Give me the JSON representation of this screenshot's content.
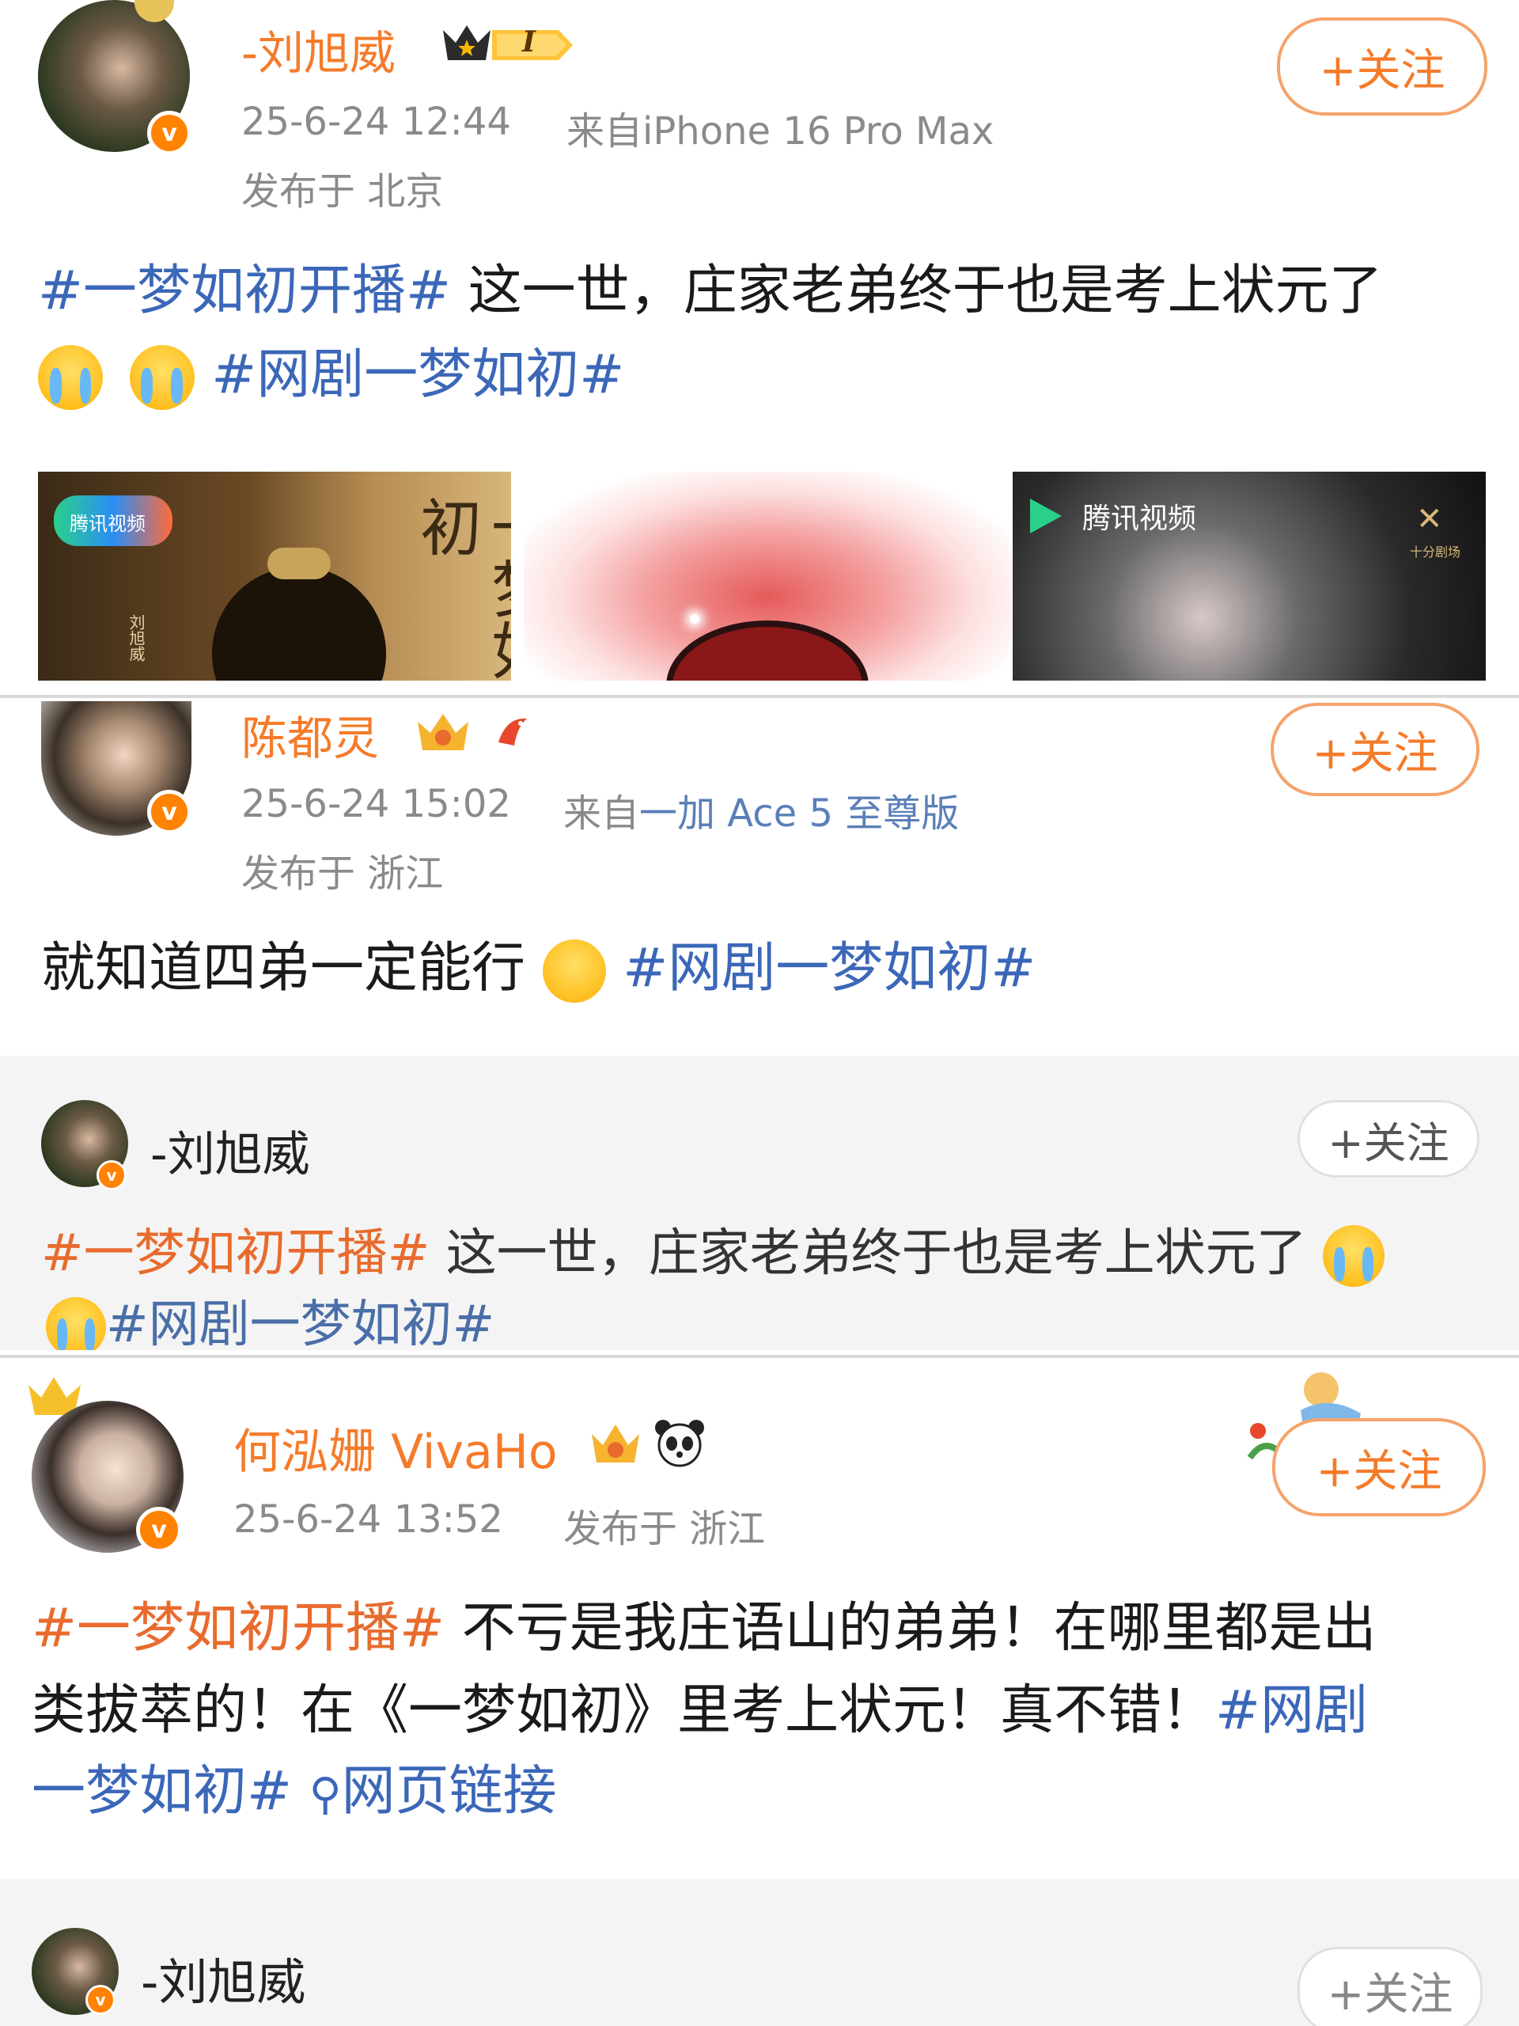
{
  "posts": [
    {
      "author": "-刘旭威",
      "vip_badge": "I",
      "time": "25-6-24 12:44",
      "source": "来自iPhone 16 Pro Max",
      "location": "发布于 北京",
      "follow": "+关注",
      "tag1": "#一梦如初开播#",
      "body": " 这一世，庄家老弟终于也是考上状元了",
      "tag2": "#网剧一梦如初#",
      "media": [
        {
          "logo": "腾讯视频",
          "title": "一梦如初",
          "side": "刘旭威"
        },
        {
          "logo": ""
        },
        {
          "logo": "腾讯视频",
          "corner": "十分剧场"
        }
      ]
    },
    {
      "author": "陈都灵",
      "time": "25-6-24 15:02",
      "source_prefix": "来自",
      "source_device": "一加 Ace 5 至尊版",
      "location": "发布于 浙江",
      "follow": "+关注",
      "body": "就知道四弟一定能行",
      "tag": "#网剧一梦如初#",
      "quote": {
        "author": "-刘旭威",
        "follow": "+关注",
        "tag1": "#一梦如初开播#",
        "body": " 这一世，庄家老弟终于也是考上状元了",
        "tag2": "#网剧一梦如初#"
      }
    },
    {
      "author": "何泓姗 VivaHo",
      "time": "25-6-24 13:52",
      "location": "发布于 浙江",
      "follow": "+关注",
      "tag1": "#一梦如初开播#",
      "line1": " 不亏是我庄语山的弟弟！在哪里都是出",
      "line2": "类拔萃的！在《一梦如初》里考上状元！真不错！",
      "tag2a": "#网剧",
      "tag2b": "一梦如初#",
      "link": "网页链接",
      "quote": {
        "author": "-刘旭威",
        "follow": "+关注"
      }
    }
  ],
  "colors": {
    "orange": "#f57b2a",
    "topic_blue": "#3b67b8",
    "meta_grey": "#8a8a8a"
  }
}
